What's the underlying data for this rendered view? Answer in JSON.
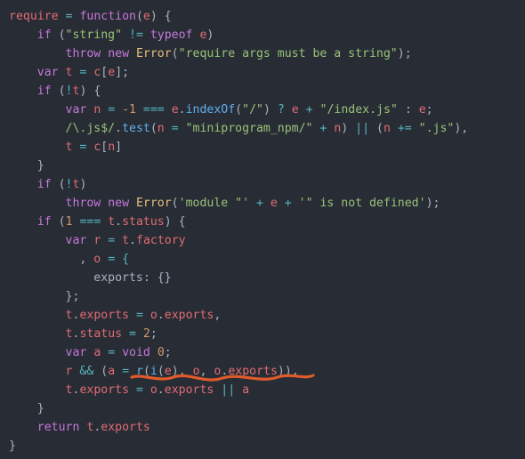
{
  "code": {
    "l1": {
      "require": "require",
      "eq": "=",
      "func": "function",
      "lp": "(",
      "e": "e",
      "rp": ")",
      "brace": " {"
    },
    "l2": {
      "if_kw": "if",
      "lp": " (",
      "str": "\"string\"",
      "neq": " != ",
      "typeof_kw": "typeof",
      "sp": " ",
      "e": "e",
      "rp": ")"
    },
    "l3": {
      "throw_kw": "throw",
      "sp": " ",
      "new_kw": "new",
      "sp2": " ",
      "err": "Error",
      "lp": "(",
      "str": "\"require args must be a string\"",
      "rp": ");"
    },
    "l4": {
      "var_kw": "var",
      "sp": " ",
      "t": "t",
      "eq": " = ",
      "c": "c",
      "lb": "[",
      "e": "e",
      "rb": "];"
    },
    "l5": {
      "if_kw": "if",
      "lp": " (",
      "not": "!",
      "t": "t",
      "rp": ") {"
    },
    "l6": {
      "var_kw": "var",
      "sp": " ",
      "n": "n",
      "eq": " = ",
      "neg1": "-1",
      "eqq": " === ",
      "e": "e",
      "dot": ".",
      "fn": "indexOf",
      "lp": "(",
      "str": "\"/\"",
      "rp": ") ",
      "q": "?",
      "sp2": " ",
      "e2": "e",
      "plus": " + ",
      "str2": "\"/index.js\"",
      "colon": " : ",
      "e3": "e",
      "semi": ";"
    },
    "l7": {
      "rx": "/\\.js$/",
      "dot": ".",
      "fn": "test",
      "lp": "(",
      "n": "n",
      "eq": " = ",
      "str": "\"miniprogram_npm/\"",
      "plus": " + ",
      "n2": "n",
      "rp": ") ",
      "or": "||",
      "sp": " (",
      "n3": "n",
      "peq": " += ",
      "str2": "\".js\"",
      "rp2": "),"
    },
    "l8": {
      "t": "t",
      "eq": " = ",
      "c": "c",
      "lb": "[",
      "n": "n",
      "rb": "]"
    },
    "l9": {
      "brace": "}"
    },
    "l10": {
      "if_kw": "if",
      "lp": " (",
      "not": "!",
      "t": "t",
      "rp": ")"
    },
    "l11": {
      "throw_kw": "throw",
      "sp": " ",
      "new_kw": "new",
      "sp2": " ",
      "err": "Error",
      "lp": "(",
      "s1": "'module \"'",
      "plus": " + ",
      "e": "e",
      "plus2": " + ",
      "s2": "'\" is not defined'",
      "rp": ");"
    },
    "l12": {
      "if_kw": "if",
      "lp": " (",
      "one": "1",
      "eqq": " === ",
      "t": "t",
      "dot": ".",
      "prop": "status",
      "rp": ") {"
    },
    "l13": {
      "var_kw": "var",
      "sp": " ",
      "r": "r",
      "eq": " = ",
      "t": "t",
      "dot": ".",
      "prop": "factory"
    },
    "l14": {
      "comma": ", ",
      "o": "o",
      "eq": " = {"
    },
    "l15": {
      "key": "exports",
      "val": ": {}"
    },
    "l16": {
      "brace": "};"
    },
    "l17": {
      "t": "t",
      "dot": ".",
      "prop": "exports",
      "eq": " = ",
      "o": "o",
      "dot2": ".",
      "prop2": "exports",
      "comma": ","
    },
    "l18": {
      "t": "t",
      "dot": ".",
      "prop": "status",
      "eq": " = ",
      "two": "2",
      "semi": ";"
    },
    "l19": {
      "var_kw": "var",
      "sp": " ",
      "a": "a",
      "eq": " = ",
      "void_kw": "void",
      "sp2": " ",
      "zero": "0",
      "semi": ";"
    },
    "l20": {
      "r": "r",
      "and": " && ",
      "lp": "(",
      "a": "a",
      "eq": " = ",
      "rfn": "r",
      "lp2": "(",
      "ifn": "i",
      "lp3": "(",
      "e": "e",
      "rp3": "), ",
      "o": "o",
      "comma": ", ",
      "o2": "o",
      "dot": ".",
      "prop": "exports",
      "rp": ")),"
    },
    "l21": {
      "t": "t",
      "dot": ".",
      "prop": "exports",
      "eq": " = ",
      "o": "o",
      "dot2": ".",
      "prop2": "exports",
      "or": " || ",
      "a": "a"
    },
    "l22": {
      "brace": "}"
    },
    "l23": {
      "return_kw": "return",
      "sp": " ",
      "t": "t",
      "dot": ".",
      "prop": "exports"
    },
    "l24": {
      "brace": "}"
    }
  },
  "annotation": {
    "color": "#e05a2b",
    "description": "wavy-underline-hand-drawn"
  }
}
